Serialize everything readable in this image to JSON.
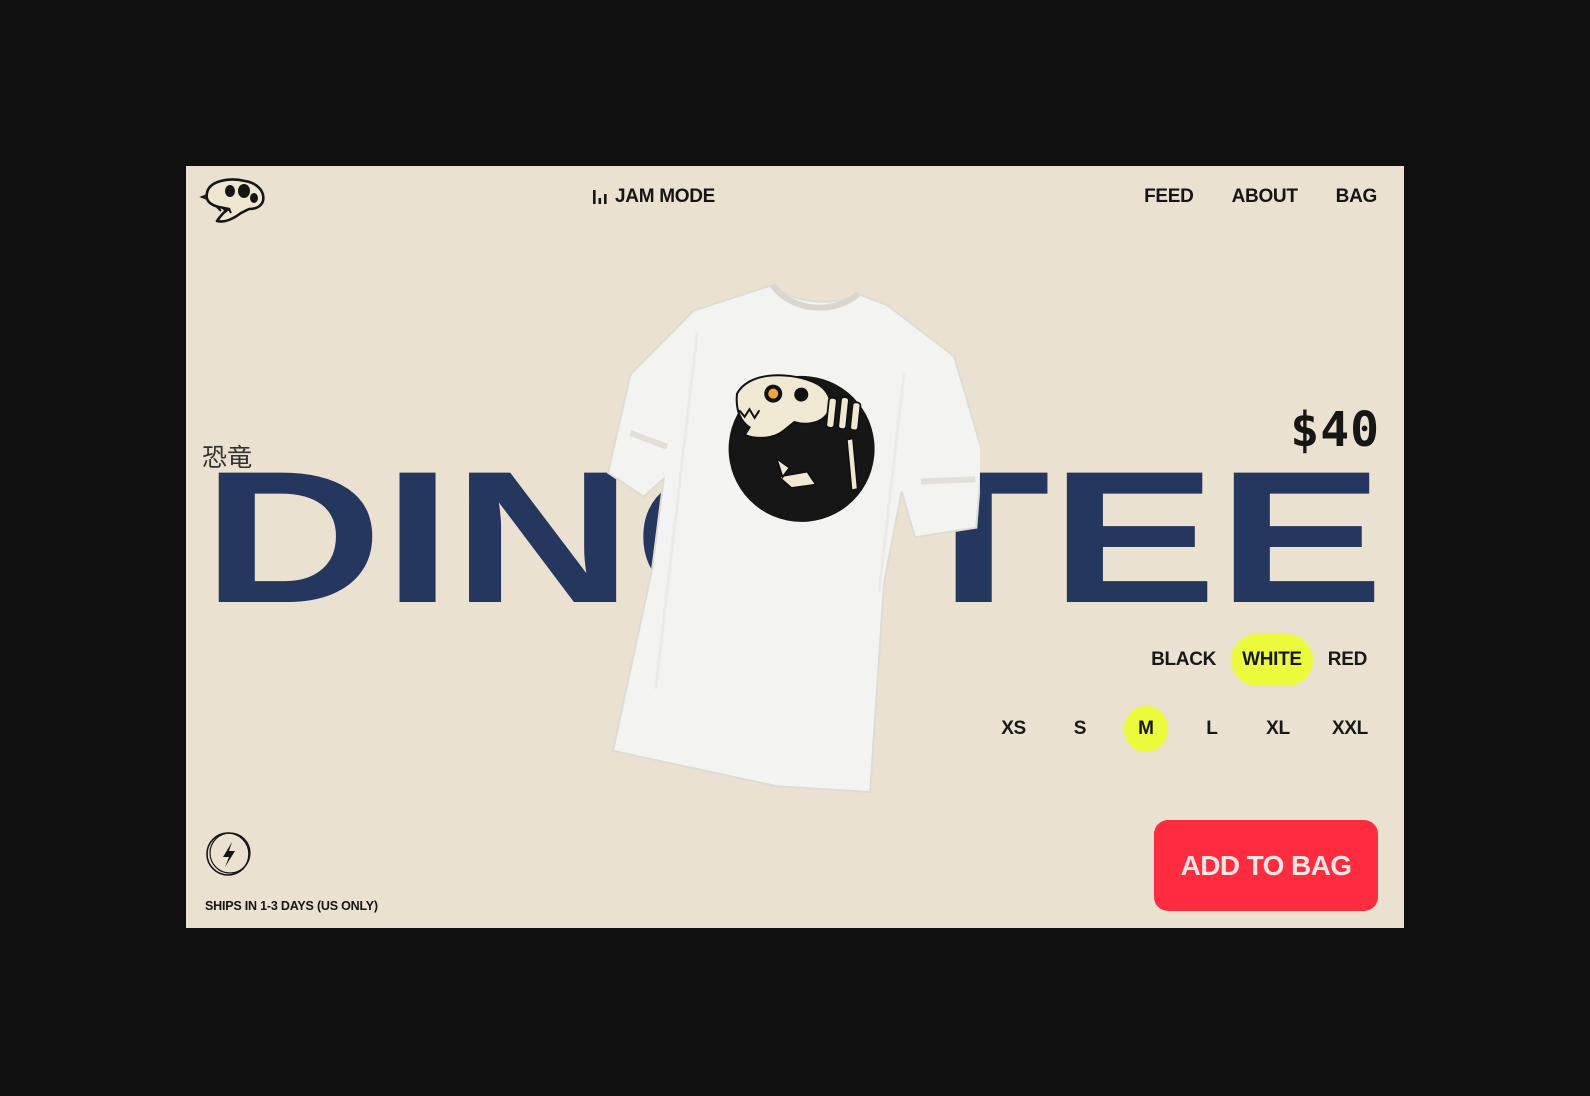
{
  "brand": {
    "logo_icon": "dino-skull-logo-icon"
  },
  "header": {
    "center_title": "JAM MODE",
    "center_icon": "equalizer-bars-icon"
  },
  "nav": {
    "items": [
      {
        "label": "FEED"
      },
      {
        "label": "ABOUT"
      },
      {
        "label": "BAG"
      }
    ]
  },
  "product": {
    "kanji": "恐竜",
    "name": "DINO TEE",
    "price": "$40",
    "image": "white-tshirt-dino-skeleton-print",
    "colors": [
      {
        "label": "BLACK"
      },
      {
        "label": "WHITE"
      },
      {
        "label": "RED"
      }
    ],
    "selected_color": "WHITE",
    "sizes": [
      {
        "label": "XS"
      },
      {
        "label": "S"
      },
      {
        "label": "M"
      },
      {
        "label": "L"
      },
      {
        "label": "XL"
      },
      {
        "label": "XXL"
      }
    ],
    "selected_size": "M"
  },
  "shipping": {
    "icon": "lightning-bolt-icon",
    "text": "SHIPS IN 1-3 DAYS (US ONLY)"
  },
  "cta": {
    "add_to_bag": "ADD TO BAG"
  },
  "theme": {
    "background": "#eae1d0",
    "headline_color": "#25375f",
    "accent_select": "#ecfb3c",
    "cta_color": "#ff2b3f"
  }
}
